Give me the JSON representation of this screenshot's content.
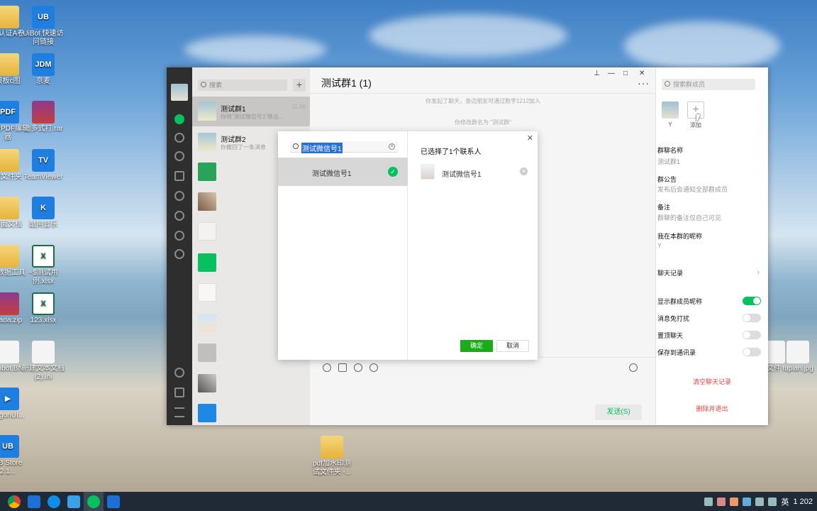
{
  "desktop": {
    "icons": [
      {
        "label": "级认证A卷",
        "kind": "folder",
        "glyph": ""
      },
      {
        "label": "UiBot 快速访问链接",
        "kind": "blue",
        "glyph": "UB"
      },
      {
        "label": "模板c图",
        "kind": "folder",
        "glyph": ""
      },
      {
        "label": "京麦",
        "kind": "blue",
        "glyph": "JDM"
      },
      {
        "label": "迅捷PDF编辑器",
        "kind": "blue",
        "glyph": "PDF"
      },
      {
        "label": "迪多式打.rar",
        "kind": "rar",
        "glyph": ""
      },
      {
        "label": "迪文件夹",
        "kind": "folder",
        "glyph": ""
      },
      {
        "label": "TeamViewer",
        "kind": "blue",
        "glyph": "TV"
      },
      {
        "label": "桌面文档",
        "kind": "folder",
        "glyph": ""
      },
      {
        "label": "酷狗音乐",
        "kind": "blue",
        "glyph": "K"
      },
      {
        "label": "取数据工具",
        "kind": "folder",
        "glyph": ""
      },
      {
        "label": "~$测试用例.xlsx",
        "kind": "excel",
        "glyph": "X"
      },
      {
        "label": "Gaoa.zip",
        "kind": "rar",
        "glyph": ""
      },
      {
        "label": "123.xlsx",
        "kind": "excel",
        "glyph": "X"
      },
      {
        "label": "Robot.BN",
        "kind": "doc",
        "glyph": ""
      },
      {
        "label": "新建文本文档(2).ini",
        "kind": "doc",
        "glyph": ""
      },
      {
        "label": "LogonUI...",
        "kind": "blue",
        "glyph": "▶"
      },
      {
        "label": "UB Store 2.1...",
        "kind": "blue",
        "glyph": "UB"
      },
      {
        "label": "pdf加水印测试文件夹 -...",
        "kind": "folder",
        "glyph": ""
      },
      {
        "label": "文件",
        "kind": "doc",
        "glyph": ""
      },
      {
        "label": "tupian.jpg",
        "kind": "doc",
        "glyph": ""
      }
    ]
  },
  "taskbar": {
    "ime": "英",
    "clock": "1 202"
  },
  "wechat": {
    "search_placeholder": "搜索",
    "add_symbol": "+",
    "chats": [
      {
        "name": "测试群1",
        "preview": "你将\"测试微信号1\"移出...",
        "time": "11:06"
      },
      {
        "name": "测试群2",
        "preview": "你撤回了一条消息",
        "time": ""
      }
    ],
    "window_controls": {
      "pin": "⊥",
      "min": "—",
      "max": "□",
      "close": "✕"
    },
    "main": {
      "title": "测试群1 (1)",
      "more": "···",
      "system_messages": [
        "你发起了聊天，身边朋友可通过数字1212加入",
        "你修改群名为 \"测试群\""
      ],
      "send_label": "发送(S)"
    },
    "side": {
      "search_placeholder": "搜索群成员",
      "member_name": "Y",
      "add_label": "添加",
      "group_name_label": "群聊名称",
      "group_name_value": "测试群1",
      "announcement_label": "群公告",
      "announcement_value": "发布后会通知全部群成员",
      "remark_label": "备注",
      "remark_value": "群聊的备注仅自己可见",
      "nickname_label": "我在本群的昵称",
      "nickname_value": "Y",
      "history_label": "聊天记录",
      "chevron": "›",
      "toggles": [
        {
          "label": "显示群成员昵称",
          "on": true
        },
        {
          "label": "消息免打扰",
          "on": false
        },
        {
          "label": "置顶聊天",
          "on": false
        },
        {
          "label": "保存到通讯录",
          "on": false
        }
      ],
      "clear_history": "清空聊天记录",
      "delete_exit": "删除并退出"
    },
    "colors": {
      "accent": "#07c160",
      "danger": "#e64340",
      "nav_bg": "#2e2e2e"
    }
  },
  "dialog": {
    "search_query": "测试微信号1",
    "clear_symbol": "✕",
    "result_name": "测试微信号1",
    "check_symbol": "✓",
    "selected_title": "已选择了1个联系人",
    "selected_name": "测试微信号1",
    "remove_symbol": "✕",
    "ok_label": "确定",
    "cancel_label": "取消",
    "close_symbol": "✕"
  }
}
